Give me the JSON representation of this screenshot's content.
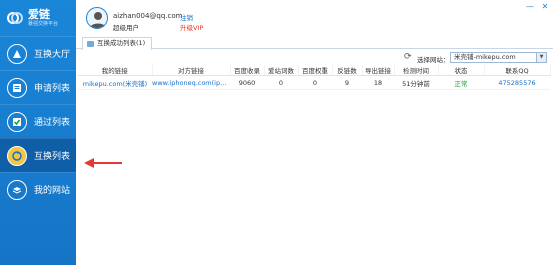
{
  "app": {
    "title": "爱链",
    "subtitle": "暴强交换平台"
  },
  "sidebar": {
    "items": [
      {
        "label": "互换大厅",
        "icon": "hall-icon",
        "active": false
      },
      {
        "label": "申请列表",
        "icon": "apply-icon",
        "active": false
      },
      {
        "label": "通过列表",
        "icon": "approved-icon",
        "active": false
      },
      {
        "label": "互换列表",
        "icon": "exchange-icon",
        "active": true
      },
      {
        "label": "我的网站",
        "icon": "website-icon",
        "active": false
      }
    ]
  },
  "header": {
    "email": "aizhan004@qq.com",
    "role": "超级用户",
    "logout": "注销",
    "vip": "升级VIP"
  },
  "window": {
    "minimize": "—",
    "close": "✕"
  },
  "tabs": [
    {
      "label": "互换成功列表(1)"
    }
  ],
  "toolbar": {
    "site_label": "选择网站：",
    "site_value": "米壳铺-mikepu.com"
  },
  "table": {
    "columns": [
      "我的链接",
      "对方链接",
      "百度收录",
      "爱站词数",
      "百度权重",
      "反链数",
      "导出链接",
      "检测时间",
      "状态",
      "联系QQ"
    ],
    "rows": [
      [
        "mikepu.com(米壳铺)",
        "www.iphoneq.com(iphone...",
        "9060",
        "0",
        "0",
        "9",
        "18",
        "51分钟前",
        "正常",
        "475285576"
      ]
    ]
  },
  "colors": {
    "sidebar": "#1a86d8",
    "link": "#1a6fc9",
    "ok": "#1a9b3a",
    "vip": "#e23a2a",
    "arrow": "#e53935"
  }
}
